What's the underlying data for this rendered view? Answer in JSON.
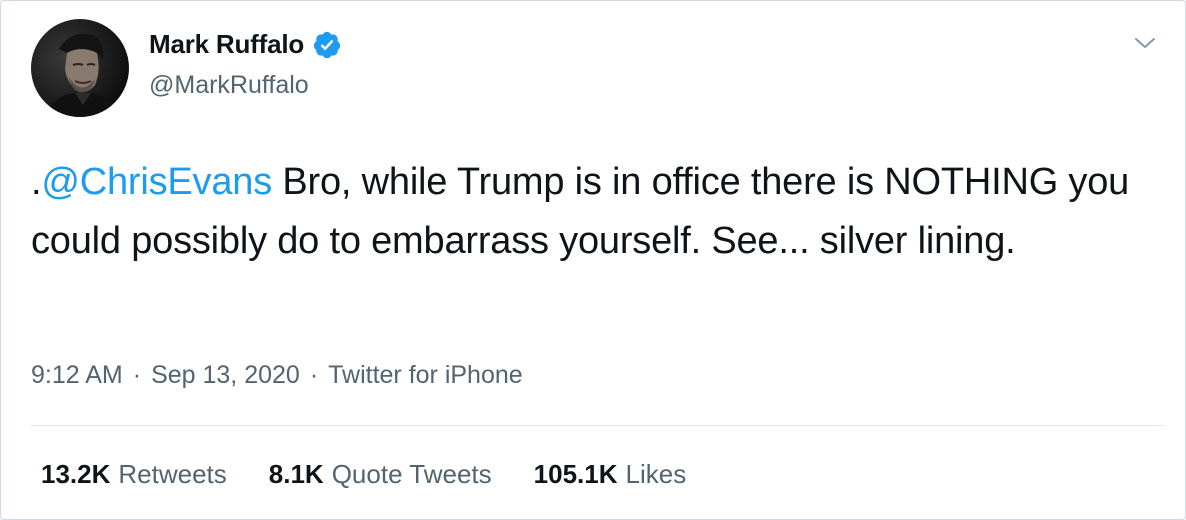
{
  "author": {
    "display_name": "Mark Ruffalo",
    "handle": "@MarkRuffalo",
    "verified_icon": "verified-badge-icon",
    "avatar": "profile-photo"
  },
  "tweet": {
    "prefix": ".",
    "mention": "@ChrisEvans",
    "text": " Bro, while Trump is in office there is NOTHING you could possibly do to embarrass yourself. See... silver lining."
  },
  "meta": {
    "time": "9:12 AM",
    "sep1": "·",
    "date": "Sep 13, 2020",
    "sep2": "·",
    "source": "Twitter for iPhone"
  },
  "stats": {
    "retweets_count": "13.2K",
    "retweets_label": "Retweets",
    "quotes_count": "8.1K",
    "quotes_label": "Quote Tweets",
    "likes_count": "105.1K",
    "likes_label": "Likes"
  },
  "colors": {
    "accent": "#1d9bf0",
    "text": "#0f1419",
    "muted": "#536471",
    "border": "#cfd9de"
  },
  "icons": {
    "menu": "chevron-down-icon"
  }
}
